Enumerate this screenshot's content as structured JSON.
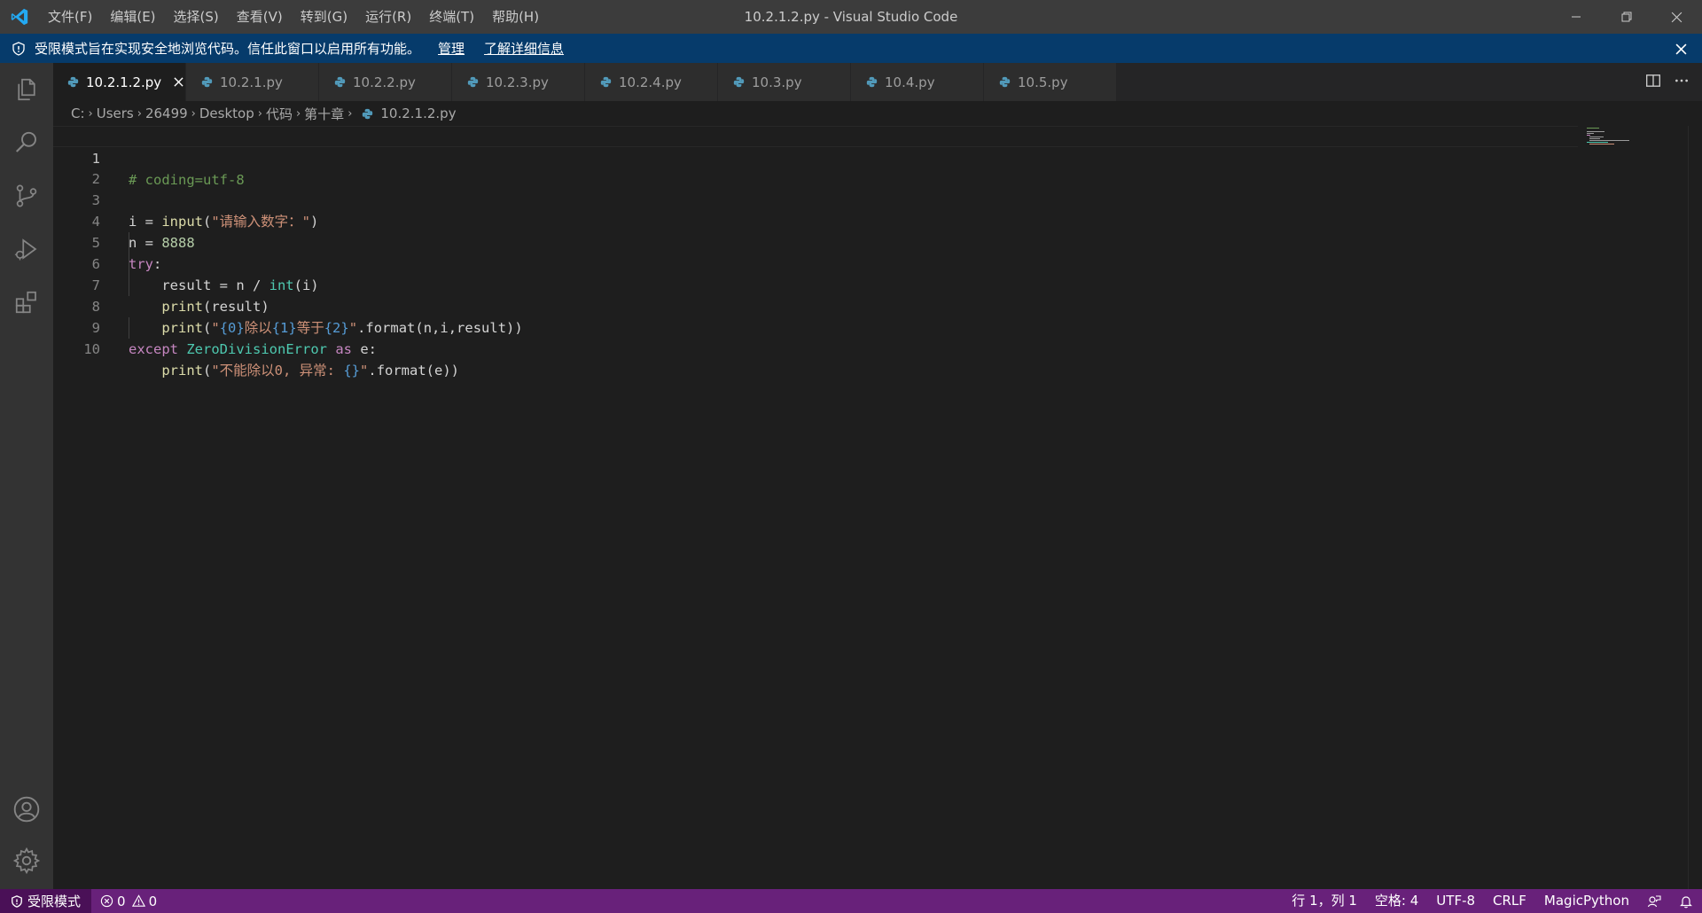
{
  "window": {
    "title": "10.2.1.2.py - Visual Studio Code",
    "menu": [
      "文件(F)",
      "编辑(E)",
      "选择(S)",
      "查看(V)",
      "转到(G)",
      "运行(R)",
      "终端(T)",
      "帮助(H)"
    ]
  },
  "banner": {
    "text": "受限模式旨在实现安全地浏览代码。信任此窗口以启用所有功能。",
    "manage": "管理",
    "learn_more": "了解详细信息"
  },
  "tabs": [
    {
      "label": "10.2.1.2.py",
      "active": true
    },
    {
      "label": "10.2.1.py",
      "active": false
    },
    {
      "label": "10.2.2.py",
      "active": false
    },
    {
      "label": "10.2.3.py",
      "active": false
    },
    {
      "label": "10.2.4.py",
      "active": false
    },
    {
      "label": "10.3.py",
      "active": false
    },
    {
      "label": "10.4.py",
      "active": false
    },
    {
      "label": "10.5.py",
      "active": false
    }
  ],
  "breadcrumb": [
    "C:",
    "Users",
    "26499",
    "Desktop",
    "代码",
    "第十章",
    "10.2.1.2.py"
  ],
  "editor": {
    "line_numbers": [
      "1",
      "2",
      "3",
      "4",
      "5",
      "6",
      "7",
      "8",
      "9",
      "10"
    ],
    "lines": {
      "l1": "# coding=utf-8",
      "l3_a": "i = ",
      "l3_b": "input",
      "l3_c": "(",
      "l3_d": "\"请输入数字：\"",
      "l3_e": ")",
      "l4_a": "n = ",
      "l4_b": "8888",
      "l5_a": "try",
      "l5_b": ":",
      "l6_a": "    result = n / ",
      "l6_b": "int",
      "l6_c": "(i)",
      "l7_a": "    ",
      "l7_b": "print",
      "l7_c": "(result)",
      "l8_a": "    ",
      "l8_b": "print",
      "l8_c": "(",
      "l8_d": "\"",
      "l8_e": "{0}",
      "l8_f": "除以",
      "l8_g": "{1}",
      "l8_h": "等于",
      "l8_i": "{2}",
      "l8_j": "\"",
      "l8_k": ".format(n,i,result))",
      "l9_a": "except",
      "l9_b": " ",
      "l9_c": "ZeroDivisionError",
      "l9_d": " ",
      "l9_e": "as",
      "l9_f": " e:",
      "l10_a": "    ",
      "l10_b": "print",
      "l10_c": "(",
      "l10_d": "\"不能除以0, 异常: ",
      "l10_e": "{}",
      "l10_f": "\"",
      "l10_g": ".format(e))"
    }
  },
  "statusbar": {
    "restricted": "受限模式",
    "errors": "0",
    "warnings": "0",
    "position": "行 1，列 1",
    "spaces": "空格: 4",
    "encoding": "UTF-8",
    "eol": "CRLF",
    "language": "MagicPython"
  },
  "colors": {
    "titlebar": "#3c3c3c",
    "banner": "#063b6b",
    "activitybar": "#333333",
    "editor": "#1e1e1e",
    "statusbar": "#68217a",
    "vscode_blue": "#23a9f2"
  }
}
